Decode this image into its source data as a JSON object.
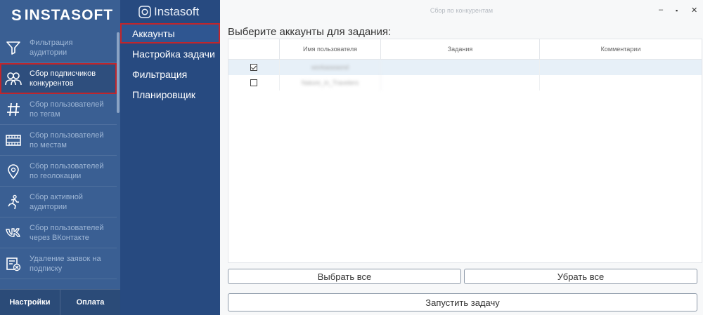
{
  "brand": {
    "name": "INSTASOFT",
    "logo_letter": "S"
  },
  "sidebar": {
    "items": [
      {
        "label": "Фильтрация аудитории",
        "icon": "funnel-icon"
      },
      {
        "label": "Сбор подписчиков конкурентов",
        "icon": "users-icon"
      },
      {
        "label": "Сбор пользователей по тегам",
        "icon": "hashtag-icon"
      },
      {
        "label": "Сбор пользователей по местам",
        "icon": "film-strip-icon"
      },
      {
        "label": "Сбор пользователей по геолокации",
        "icon": "map-pin-icon"
      },
      {
        "label": "Сбор активной аудитории",
        "icon": "running-person-icon"
      },
      {
        "label": "Сбор пользователей через ВКонтакте",
        "icon": "vk-icon"
      },
      {
        "label": "Удаление заявок на подписку",
        "icon": "remove-request-icon"
      }
    ],
    "active_index": 1,
    "footer": {
      "settings_label": "Настройки",
      "payment_label": "Оплата"
    }
  },
  "subpanel": {
    "brand": "Instasoft",
    "items": [
      "Аккаунты",
      "Настройка задачи",
      "Фильтрация",
      "Планировщик"
    ],
    "active_index": 0
  },
  "window": {
    "title": "Сбор по конкурентам",
    "minimize": "–",
    "maximize": "▪",
    "close": "✕"
  },
  "main": {
    "heading": "Выберите аккаунты для задания:",
    "table": {
      "columns": [
        "",
        "Имя пользователя",
        "Задания",
        "Комментарии"
      ],
      "rows": [
        {
          "checked": true,
          "username": "workaseasnd",
          "tasks": "",
          "comments": ""
        },
        {
          "checked": false,
          "username": "Nature_in_Travelers",
          "tasks": "",
          "comments": ""
        }
      ]
    },
    "select_all_label": "Выбрать все",
    "deselect_all_label": "Убрать все",
    "start_task_label": "Запустить задачу"
  },
  "colors": {
    "sidebar_bg": "#3a5f93",
    "subpanel_bg": "#274a80",
    "highlight": "#c0262c",
    "selected_row": "#e7f0f8"
  }
}
